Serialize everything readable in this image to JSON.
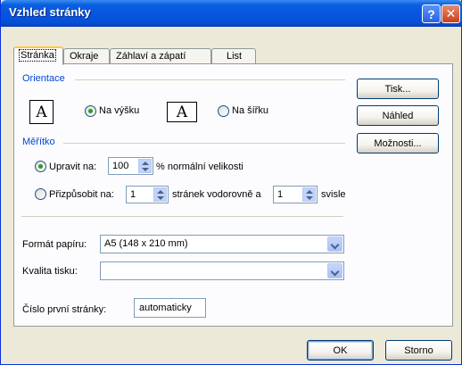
{
  "window": {
    "title": "Vzhled stránky"
  },
  "tabs": [
    "Stránka",
    "Okraje",
    "Záhlaví a zápatí",
    "List"
  ],
  "orientation": {
    "group_label": "Orientace",
    "portrait_label": "Na výšku",
    "landscape_label": "Na šířku",
    "selected": "portrait"
  },
  "scaling": {
    "group_label": "Měřítko",
    "adjust_label": "Upravit na:",
    "adjust_value": "100",
    "adjust_suffix": "% normální velikosti",
    "fit_label": "Přizpůsobit na:",
    "fit_wide_value": "1",
    "fit_wide_suffix": "stránek vodorovně a",
    "fit_tall_value": "1",
    "fit_tall_suffix": "svisle",
    "selected": "adjust"
  },
  "paper": {
    "label": "Formát papíru:",
    "value": "A5 (148 x 210 mm)"
  },
  "quality": {
    "label": "Kvalita tisku:",
    "value": ""
  },
  "first_page": {
    "label": "Číslo první stránky:",
    "value": "automaticky"
  },
  "side_buttons": {
    "print": "Tisk...",
    "preview": "Náhled",
    "options": "Možnosti..."
  },
  "footer": {
    "ok": "OK",
    "cancel": "Storno"
  },
  "icons": {
    "portrait": "A",
    "landscape": "A",
    "help": "?",
    "close": "✕"
  },
  "colors": {
    "titlebar": "#0855dd",
    "group_label": "#0046d5",
    "radio_dot": "#21a121"
  }
}
